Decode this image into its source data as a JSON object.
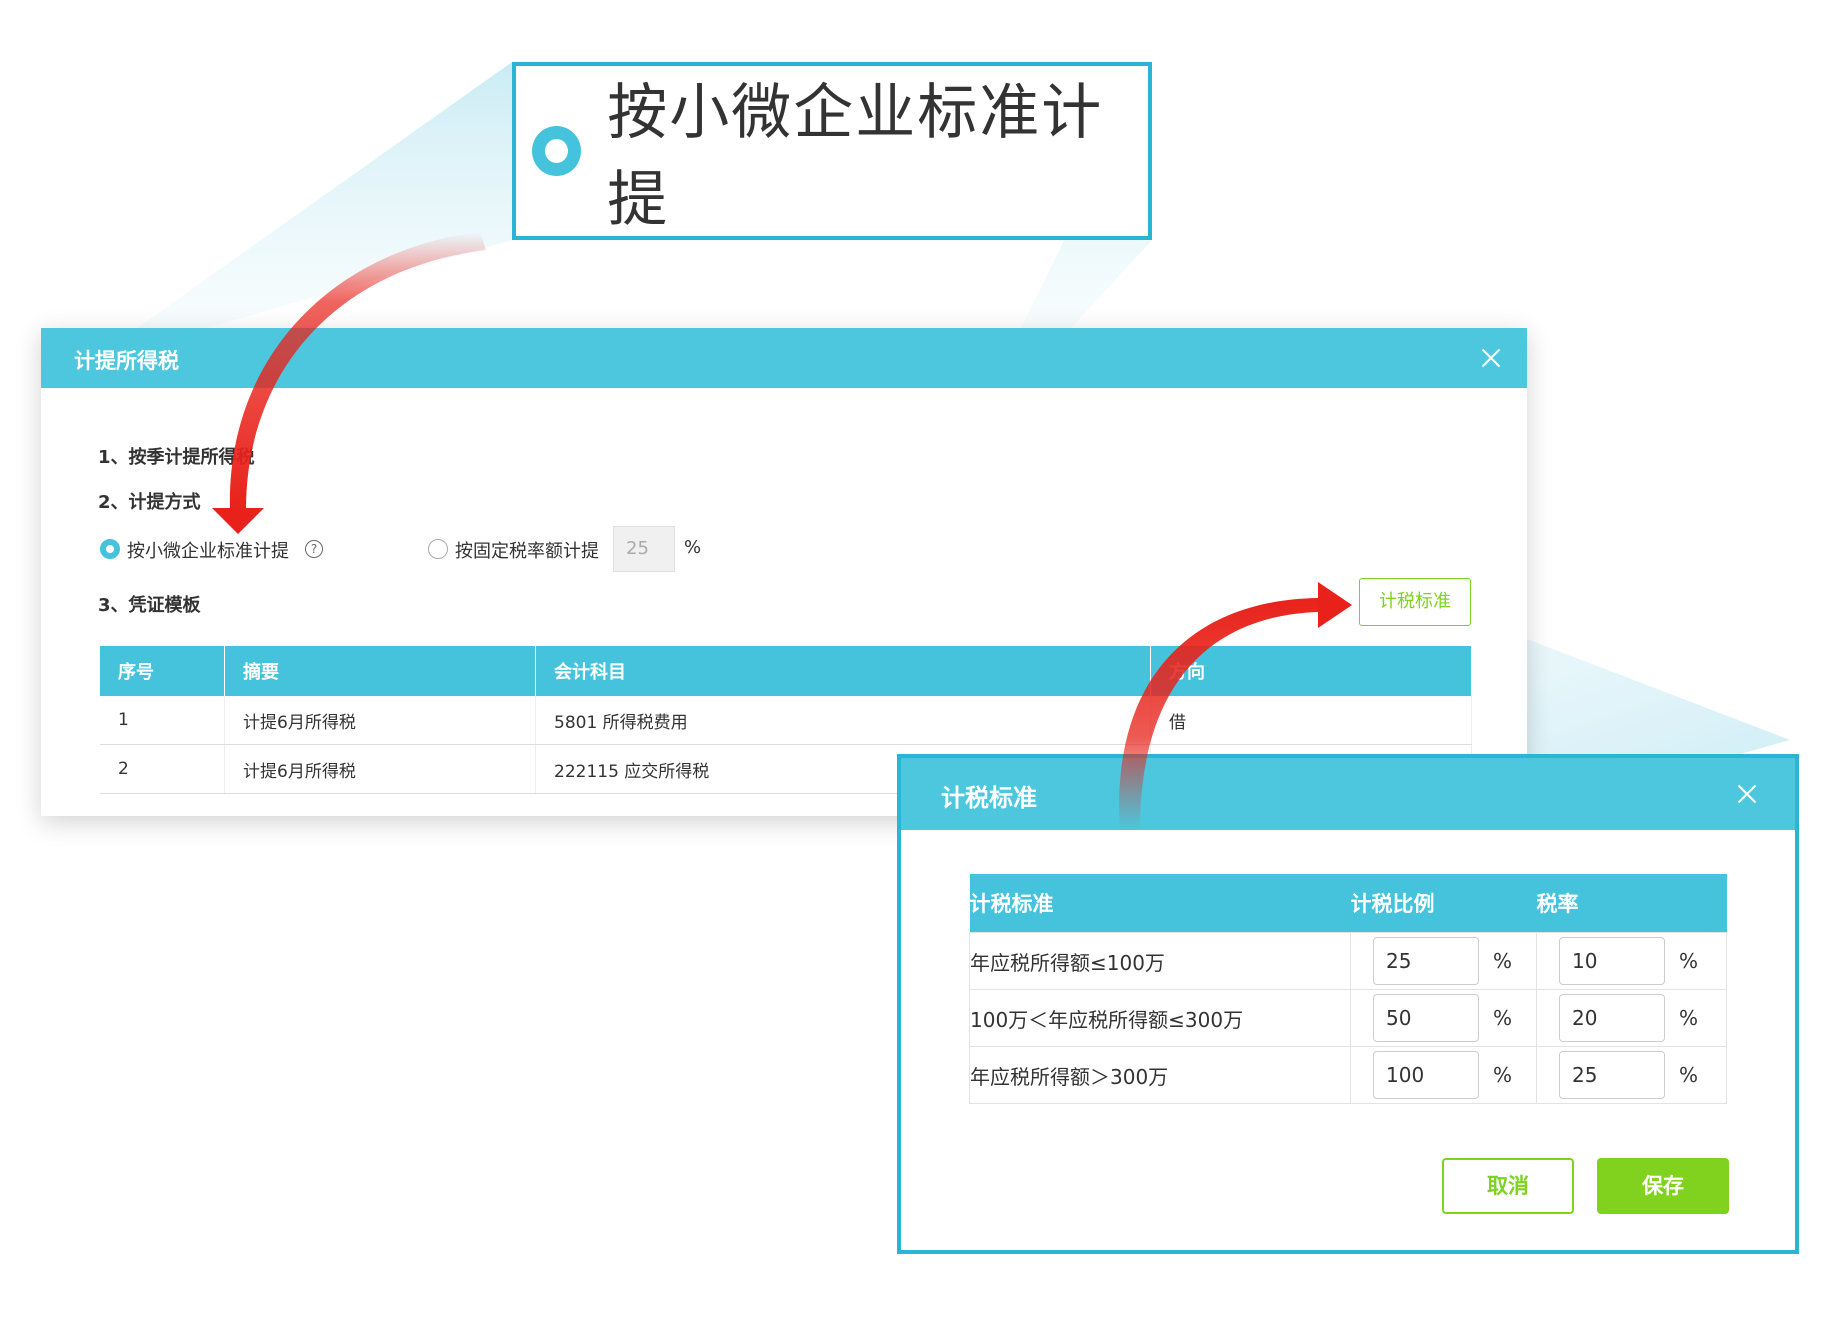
{
  "zoom_callout": {
    "label": "按小微企业标准计提"
  },
  "main_dialog": {
    "title": "计提所得税",
    "step1": "1、按季计提所得税",
    "step2": "2、计提方式",
    "option_small": "按小微企业标准计提",
    "help_icon": "?",
    "option_fixed": "按固定税率额计提",
    "fixed_rate_value": "25",
    "percent": "%",
    "step3": "3、凭证模板",
    "tax_standard_button": "计税标准",
    "table": {
      "headers": [
        "序号",
        "摘要",
        "会计科目",
        "方向"
      ],
      "rows": [
        [
          "1",
          "计提6月所得税",
          "5801 所得税费用",
          "借"
        ],
        [
          "2",
          "计提6月所得税",
          "222115 应交所得税",
          ""
        ]
      ]
    }
  },
  "tax_dialog": {
    "title": "计税标准",
    "headers": [
      "计税标准",
      "计税比例",
      "税率"
    ],
    "rows": [
      {
        "standard": "年应税所得额≤100万",
        "ratio": "25",
        "rate": "10"
      },
      {
        "standard": "100万＜年应税所得额≤300万",
        "ratio": "50",
        "rate": "20"
      },
      {
        "standard": "年应税所得额＞300万",
        "ratio": "100",
        "rate": "25"
      }
    ],
    "percent": "%",
    "cancel": "取消",
    "save": "保存"
  },
  "colors": {
    "header": "#4cc7dd",
    "accent_green": "#7ed321",
    "border_blue": "#29b5d3",
    "arrow": "#e8221a"
  }
}
